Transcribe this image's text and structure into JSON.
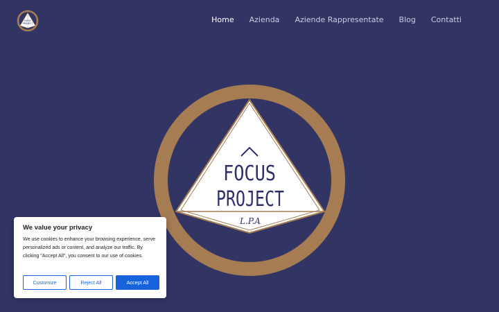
{
  "site": {
    "logo_text_line1": "FOCUS",
    "logo_text_line2": "PROJECT",
    "logo_subtitle": "L.P.A"
  },
  "nav": {
    "items": [
      {
        "label": "Home",
        "active": true
      },
      {
        "label": "Azienda",
        "active": false
      },
      {
        "label": "Aziende Rappresentate",
        "active": false
      },
      {
        "label": "Blog",
        "active": false
      },
      {
        "label": "Contatti",
        "active": false
      }
    ]
  },
  "cookie_banner": {
    "title": "We value your privacy",
    "text": "We use cookies to enhance your browsing experience, serve personalized ads or content, and analyze our traffic. By clicking \"Accept All\", you consent to our use of cookies.",
    "customize_label": "Customize",
    "reject_label": "Reject All",
    "accept_label": "Accept All"
  },
  "colors": {
    "background": "#323564",
    "ring": "#a67c52",
    "navy": "#2d2f6b",
    "accent_blue": "#1863dc"
  }
}
